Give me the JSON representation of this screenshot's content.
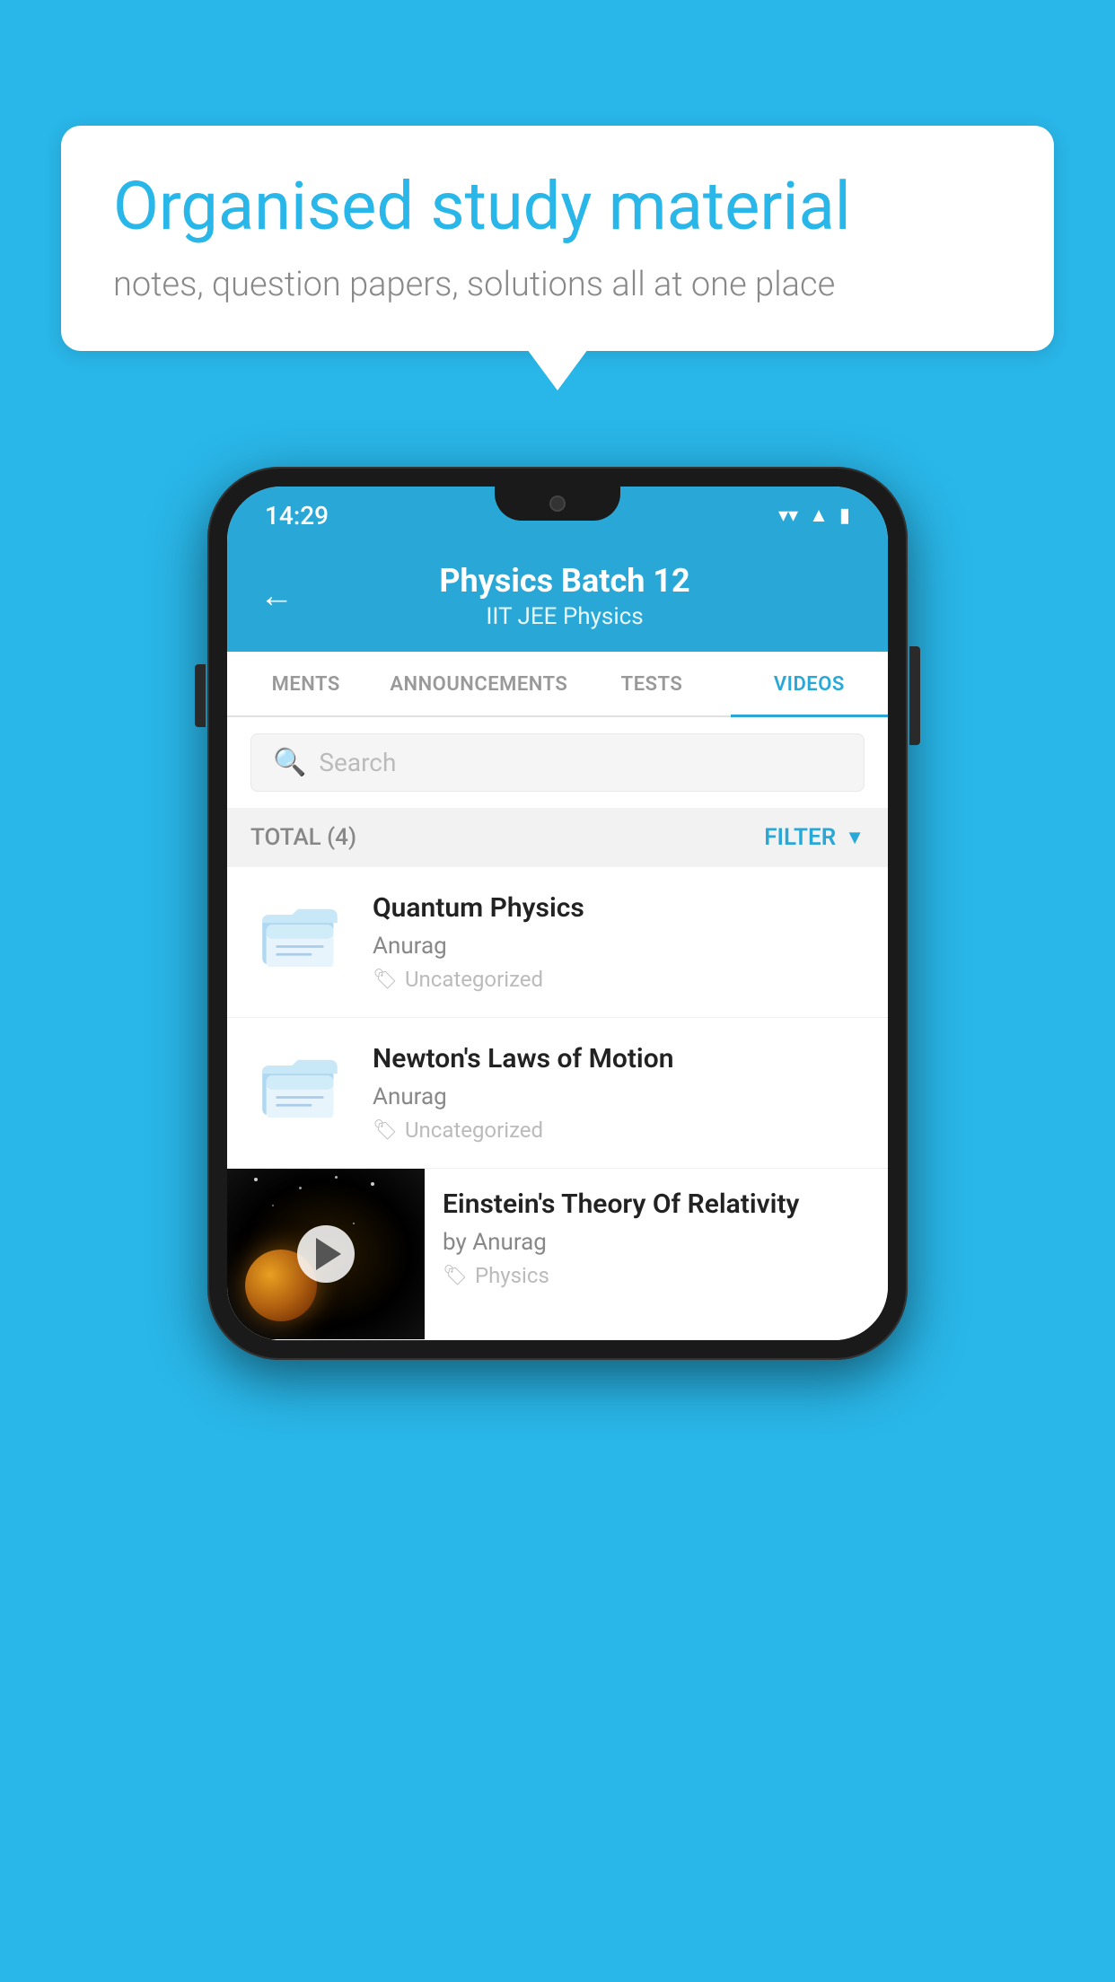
{
  "bubble": {
    "title": "Organised study material",
    "subtitle": "notes, question papers, solutions all at one place"
  },
  "statusBar": {
    "time": "14:29"
  },
  "appBar": {
    "title": "Physics Batch 12",
    "subtitle": "IIT JEE   Physics",
    "back_label": "←"
  },
  "tabs": [
    {
      "label": "MENTS",
      "active": false
    },
    {
      "label": "ANNOUNCEMENTS",
      "active": false
    },
    {
      "label": "TESTS",
      "active": false
    },
    {
      "label": "VIDEOS",
      "active": true
    }
  ],
  "search": {
    "placeholder": "Search"
  },
  "filter": {
    "total": "TOTAL (4)",
    "label": "FILTER"
  },
  "videos": [
    {
      "title": "Quantum Physics",
      "author": "Anurag",
      "tag": "Uncategorized",
      "type": "folder"
    },
    {
      "title": "Newton's Laws of Motion",
      "author": "Anurag",
      "tag": "Uncategorized",
      "type": "folder"
    },
    {
      "title": "Einstein's Theory Of Relativity",
      "author": "by Anurag",
      "tag": "Physics",
      "type": "video"
    }
  ]
}
